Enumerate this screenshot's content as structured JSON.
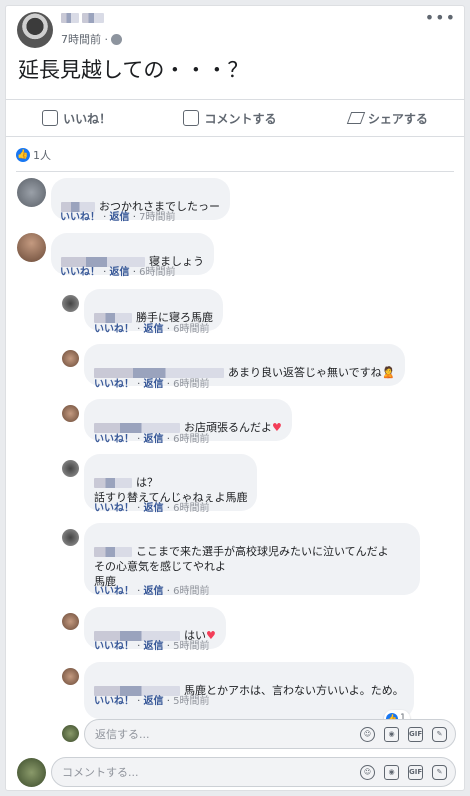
{
  "post": {
    "time": "7時間前 ·",
    "text": "延長見越しての・・・？",
    "more_label": "•••",
    "icons": {
      "privacy": "globe-icon"
    }
  },
  "actions": {
    "like": "いいね！",
    "comment": "コメントする",
    "share": "シェアする"
  },
  "likes_count": "1人",
  "comments": [
    {
      "text": "おつかれさまでしたっー",
      "like": "いいね！",
      "reply": "返信",
      "time": "7時間前"
    },
    {
      "text": "寝ましょう",
      "like": "いいね！",
      "reply": "返信",
      "time": "6時間前"
    }
  ],
  "replies": [
    {
      "text": "勝手に寝ろ馬鹿",
      "like": "いいね！",
      "reply": "返信",
      "time": "6時間前"
    },
    {
      "text": "あまり良い返答じゃ無いですね🙎",
      "like": "いいね！",
      "reply": "返信",
      "time": "6時間前"
    },
    {
      "text": "お店頑張るんだよ",
      "heart": "♥",
      "like": "いいね！",
      "reply": "返信",
      "time": "6時間前"
    },
    {
      "text": "は？\n話すり替えてんじゃねぇよ馬鹿",
      "like": "いいね！",
      "reply": "返信",
      "time": "6時間前"
    },
    {
      "text": "ここまで来た選手が高校球児みたいに泣いてんだよ\nその心意気を感じてやれよ\n馬鹿",
      "like": "いいね！",
      "reply": "返信",
      "time": "6時間前"
    },
    {
      "text": "はい",
      "heart": "♥",
      "like": "いいね！",
      "reply": "返信",
      "time": "5時間前"
    },
    {
      "text": "馬鹿とかアホは、言わない方いいよ。ため。",
      "like": "いいね！",
      "reply": "返信",
      "time": "5時間前",
      "reaction_count": "1"
    }
  ],
  "reply_input": {
    "placeholder": "返信する..."
  },
  "comment_input": {
    "placeholder": "コメントする..."
  },
  "colors": {
    "link": "#385898",
    "like_blue": "#1877f2",
    "heart": "#f33e58",
    "bubble": "#f0f2f5"
  }
}
